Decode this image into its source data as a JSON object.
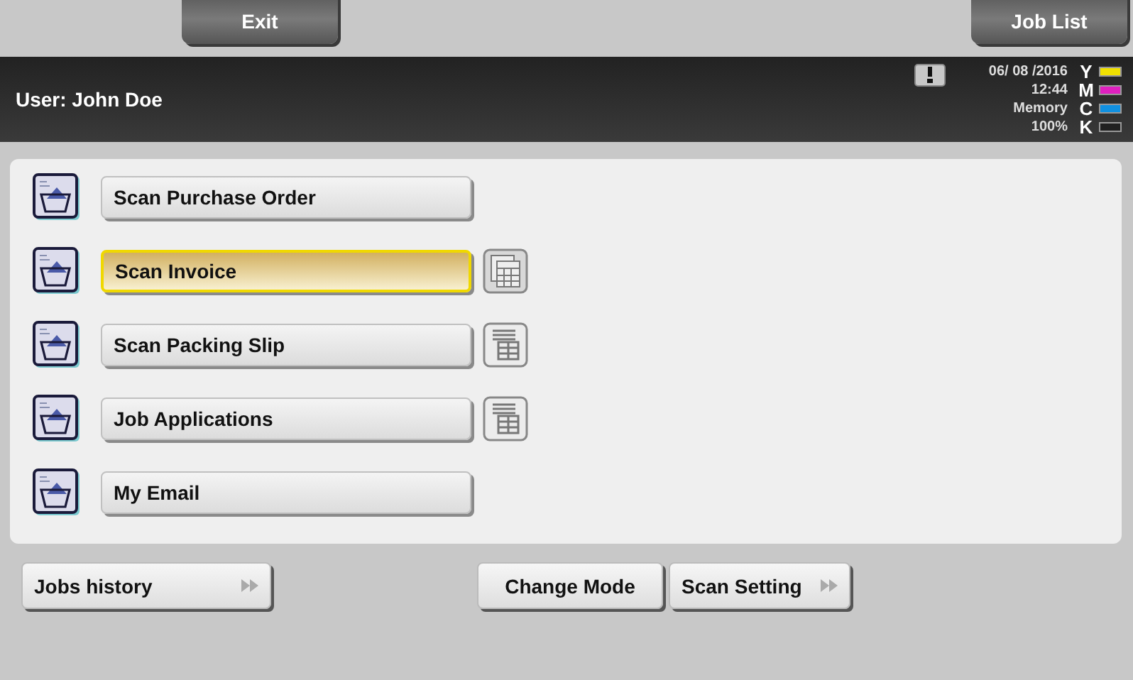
{
  "top_buttons": [
    {
      "label": "Exit"
    },
    {
      "label": "Job List"
    }
  ],
  "header": {
    "user": "User: John Doe",
    "date": "06/ 08 /2016",
    "time": "12:44",
    "memory_label": "Memory",
    "memory_value": "100%",
    "toner": [
      {
        "label": "Y",
        "color": "#f0e000"
      },
      {
        "label": "M",
        "color": "#e020c0"
      },
      {
        "label": "C",
        "color": "#1090e0"
      },
      {
        "label": "K",
        "color": "#202020"
      }
    ]
  },
  "programs": [
    {
      "label": "Scan Purchase Order",
      "selected": false,
      "list_icon": false
    },
    {
      "label": "Scan Invoice",
      "selected": true,
      "list_icon": true
    },
    {
      "label": "Scan Packing Slip",
      "selected": false,
      "list_icon": true
    },
    {
      "label": "Job Applications",
      "selected": false,
      "list_icon": true
    },
    {
      "label": "My Email",
      "selected": false,
      "list_icon": false
    }
  ],
  "bottom": {
    "jobs_history": "Jobs history",
    "change_mode": "Change Mode",
    "scan_setting": "Scan Setting"
  }
}
